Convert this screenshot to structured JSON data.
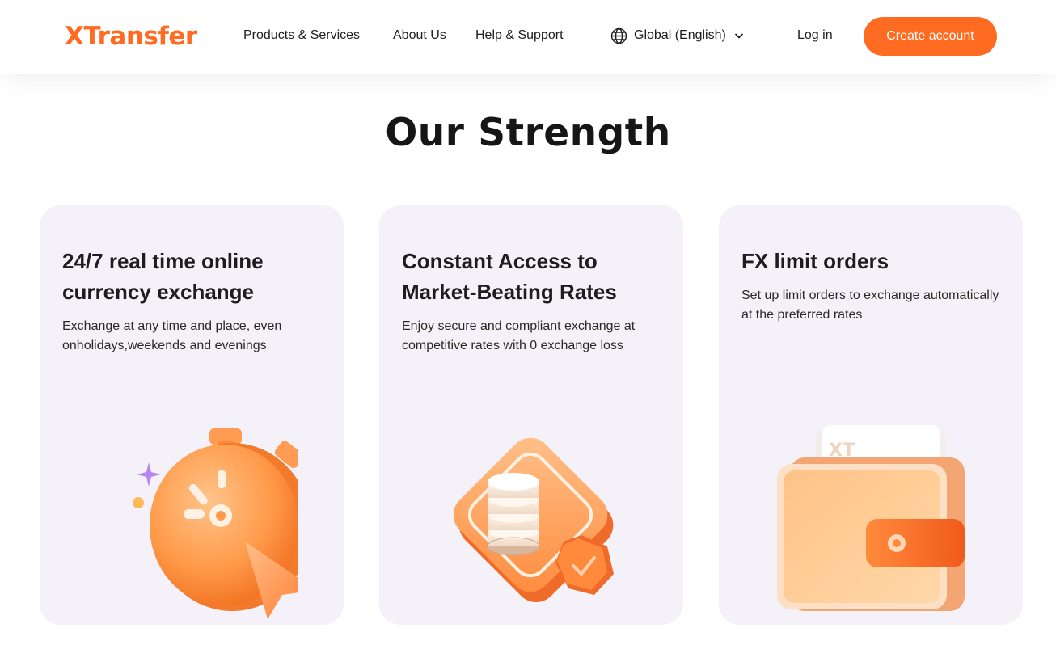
{
  "header": {
    "logo_text": "XTransfer",
    "nav": [
      "Products & Services",
      "About Us",
      "Help & Support"
    ],
    "language_label": "Global (English)",
    "login_label": "Log in",
    "cta_label": "Create account"
  },
  "section": {
    "title": "Our Strength"
  },
  "cards": [
    {
      "title": "24/7 real time online currency exchange",
      "description": "Exchange at any time and place, even onholidays,weekends and evenings",
      "icon": "stopwatch-icon"
    },
    {
      "title": "Constant Access to Market-Beating Rates",
      "description": "Enjoy secure and compliant exchange at competitive rates with 0 exchange loss",
      "icon": "coin-stack-shield-icon"
    },
    {
      "title": "FX limit orders",
      "description": "Set up limit orders to exchange automatically at the preferred rates",
      "icon": "wallet-icon",
      "badge_text": "XT"
    }
  ],
  "colors": {
    "brand": "#ff6b21",
    "card_bg": "#f4f2f8",
    "text": "#1d1d1f"
  }
}
